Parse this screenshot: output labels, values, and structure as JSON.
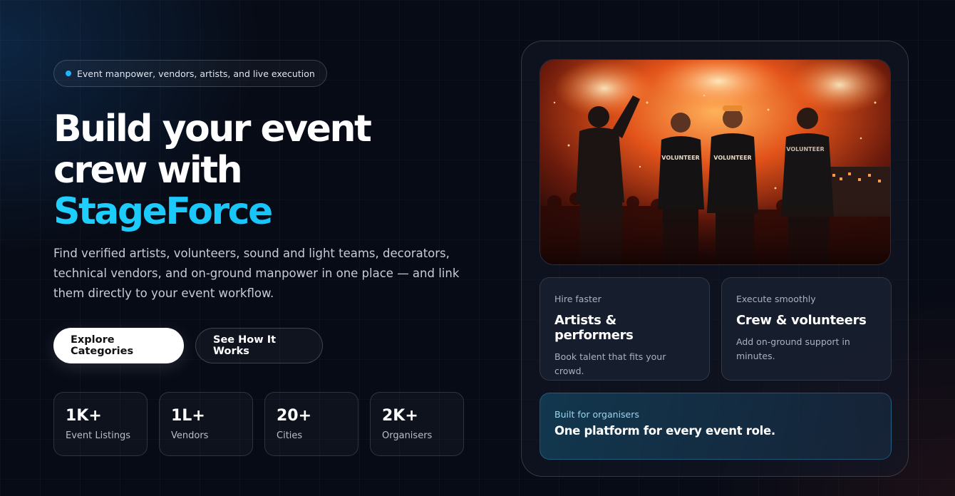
{
  "hero": {
    "badge": "Event manpower, vendors, artists, and live execution",
    "title_line1": "Build your event",
    "title_line2": "crew with",
    "title_accent": "StageForce",
    "description": "Find verified artists, volunteers, sound and light teams, decorators, technical vendors, and on-ground manpower in one place — and link them directly to your event workflow.",
    "primary_button": "Explore Categories",
    "secondary_button": "See How It Works"
  },
  "stats": [
    {
      "value": "1K+",
      "label": "Event Listings"
    },
    {
      "value": "1L+",
      "label": "Vendors"
    },
    {
      "value": "20+",
      "label": "Cities"
    },
    {
      "value": "2K+",
      "label": "Organisers"
    }
  ],
  "panel": {
    "photo": {
      "shirt_text_1": "VOLUNTEER",
      "shirt_text_2": "VOLUNTEER",
      "shirt_text_3": "VOLUNTEER"
    },
    "cards": [
      {
        "eyebrow": "Hire faster",
        "title": "Artists & performers",
        "description": "Book talent that fits your crowd."
      },
      {
        "eyebrow": "Execute smoothly",
        "title": "Crew & volunteers",
        "description": "Add on-ground support in minutes."
      }
    ],
    "highlight": {
      "eyebrow": "Built for organisers",
      "title": "One platform for every event role."
    }
  },
  "colors": {
    "accent": "#11b8f3",
    "background": "#070b16",
    "badge_dot": "#1fb6ff"
  }
}
